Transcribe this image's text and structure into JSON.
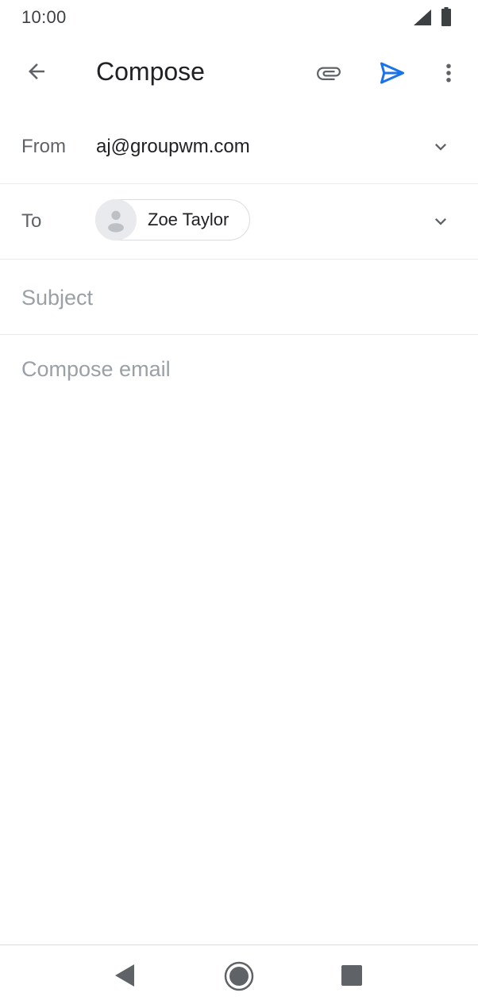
{
  "status_bar": {
    "time": "10:00",
    "icons": [
      "signal-icon",
      "battery-icon"
    ]
  },
  "app_bar": {
    "title": "Compose",
    "actions": [
      "arrow-left-icon",
      "paperclip-icon",
      "send-icon",
      "more-vert-icon"
    ],
    "accent_color": "#1a73e8"
  },
  "from": {
    "label": "From",
    "value": "aj@groupwm.com"
  },
  "to": {
    "label": "To",
    "recipients": [
      {
        "name": "Zoe Taylor",
        "avatar": "person-icon"
      }
    ]
  },
  "subject": {
    "placeholder": "Subject",
    "value": ""
  },
  "body": {
    "placeholder": "Compose email",
    "value": ""
  },
  "nav_bar": {
    "buttons": [
      "nav-back-icon",
      "nav-home-icon",
      "nav-recents-icon"
    ]
  }
}
